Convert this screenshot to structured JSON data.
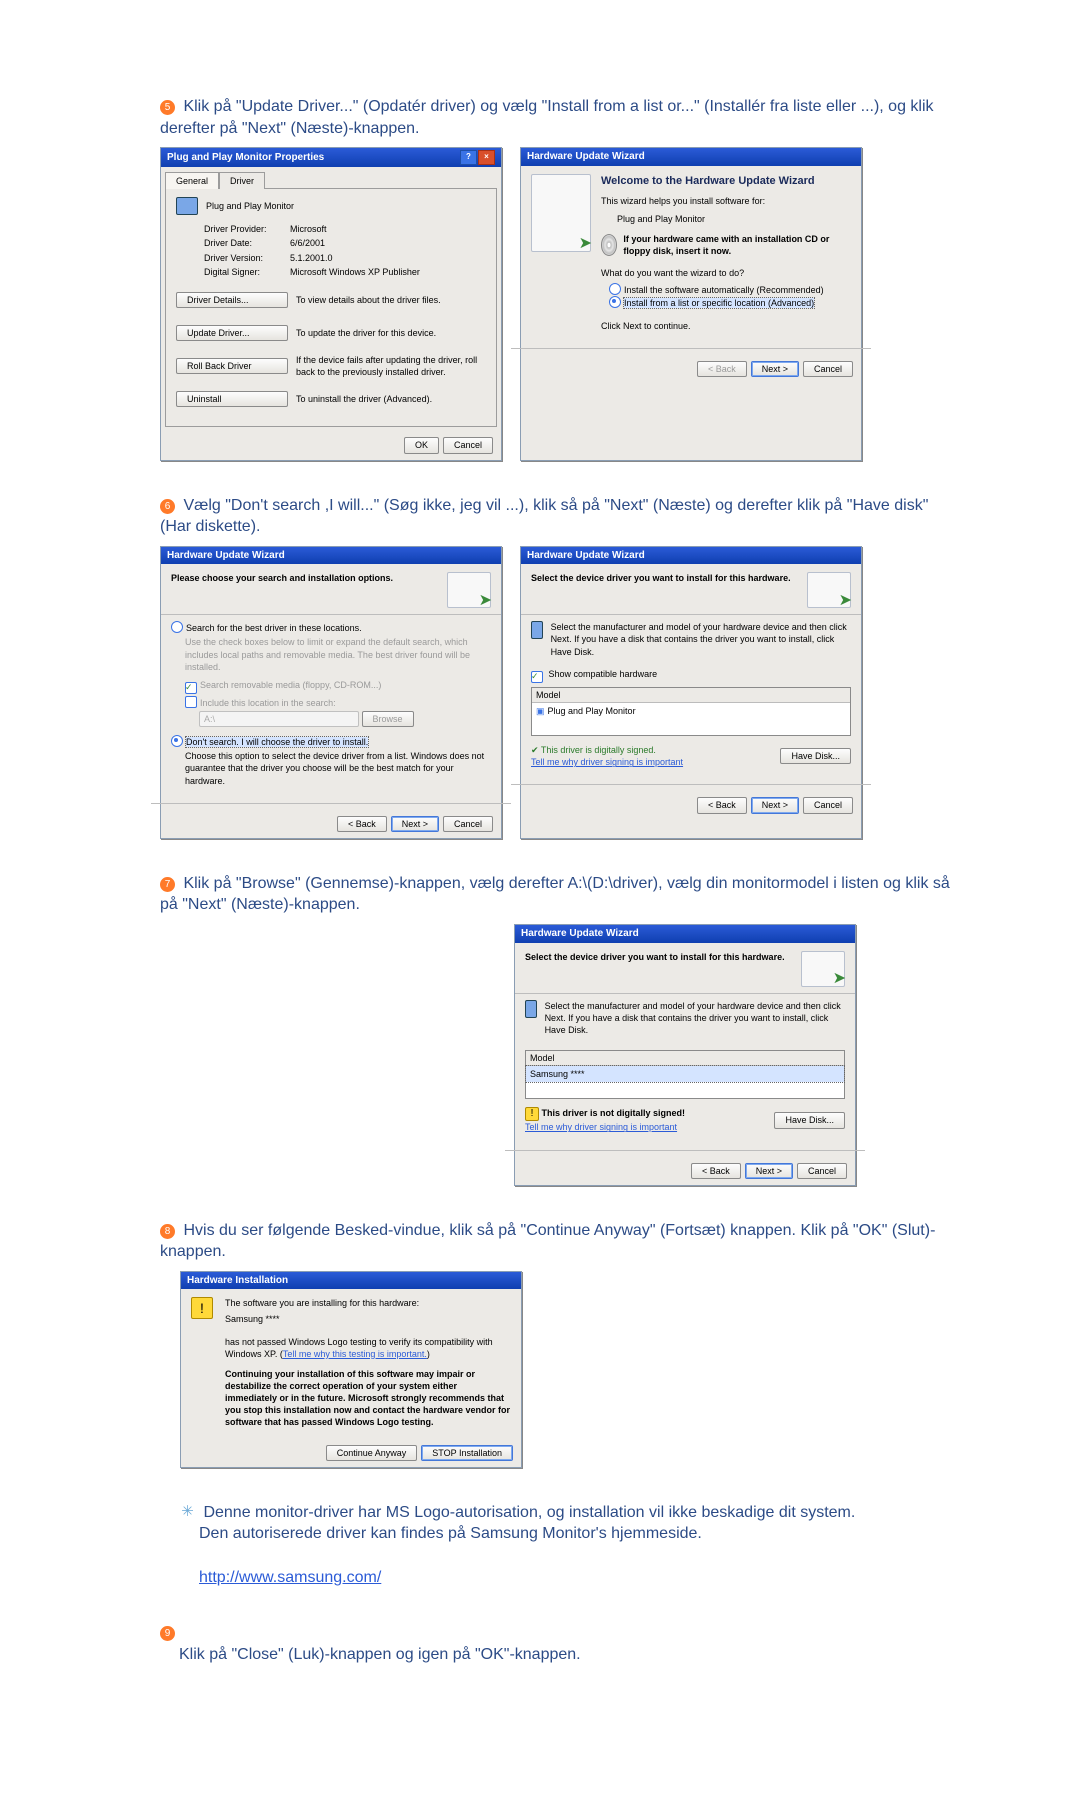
{
  "steps": {
    "s5": "Klik på \"Update Driver...\" (Opdatér driver) og vælg \"Install from a list or...\" (Installér fra liste eller ...), og klik derefter på \"Next\" (Næste)-knappen.",
    "s6": "Vælg \"Don't search ,I will...\" (Søg ikke, jeg vil ...), klik så på \"Next\" (Næste) og derefter klik på \"Have disk\" (Har diskette).",
    "s7": "Klik på \"Browse\" (Gennemse)-knappen, vælg derefter A:\\(D:\\driver), vælg din monitormodel i listen og klik så på \"Next\" (Næste)-knappen.",
    "s8": "Hvis du ser følgende Besked-vindue, klik så på \"Continue Anyway\" (Fortsæt) knappen. Klik på \"OK\" (Slut)-knappen.",
    "s9": "Klik på \"Close\" (Luk)-knappen og igen på \"OK\"-knappen."
  },
  "note": {
    "l1": "Denne monitor-driver har MS Logo-autorisation, og installation vil ikke beskadige dit system.",
    "l2": "Den autoriserede driver kan findes på Samsung Monitor's hjemmeside.",
    "link": "http://www.samsung.com/"
  },
  "common_btns": {
    "back": "< Back",
    "next": "Next >",
    "cancel": "Cancel",
    "ok": "OK",
    "have_disk": "Have Disk...",
    "browse": "Browse",
    "continue": "Continue Anyway",
    "stop": "STOP Installation"
  },
  "dlg_props": {
    "title": "Plug and Play Monitor Properties",
    "tabs": {
      "general": "General",
      "driver": "Driver"
    },
    "heading": "Plug and Play Monitor",
    "fields": {
      "provider_l": "Driver Provider:",
      "provider_v": "Microsoft",
      "date_l": "Driver Date:",
      "date_v": "6/6/2001",
      "version_l": "Driver Version:",
      "version_v": "5.1.2001.0",
      "signer_l": "Digital Signer:",
      "signer_v": "Microsoft Windows XP Publisher"
    },
    "btns": {
      "details": "Driver Details...",
      "details_d": "To view details about the driver files.",
      "update": "Update Driver...",
      "update_d": "To update the driver for this device.",
      "roll": "Roll Back Driver",
      "roll_d": "If the device fails after updating the driver, roll back to the previously installed driver.",
      "uninst": "Uninstall",
      "uninst_d": "To uninstall the driver (Advanced)."
    }
  },
  "dlg_wiz1": {
    "title": "Hardware Update Wizard",
    "welcome": "Welcome to the Hardware Update Wizard",
    "sub": "This wizard helps you install software for:",
    "device": "Plug and Play Monitor",
    "cd_hint": "If your hardware came with an installation CD or floppy disk, insert it now.",
    "q": "What do you want the wizard to do?",
    "r1": "Install the software automatically (Recommended)",
    "r2": "Install from a list or specific location (Advanced)",
    "cont": "Click Next to continue."
  },
  "dlg_wiz2": {
    "title": "Hardware Update Wizard",
    "heading": "Please choose your search and installation options.",
    "r_search": "Search for the best driver in these locations.",
    "r_search_d": "Use the check boxes below to limit or expand the default search, which includes local paths and removable media. The best driver found will be installed.",
    "c1": "Search removable media (floppy, CD-ROM...)",
    "c2": "Include this location in the search:",
    "path": "A:\\",
    "r_dont": "Don't search. I will choose the driver to install.",
    "r_dont_d": "Choose this option to select the device driver from a list. Windows does not guarantee that the driver you choose will be the best match for your hardware."
  },
  "dlg_wiz3": {
    "title": "Hardware Update Wizard",
    "heading": "Select the device driver you want to install for this hardware.",
    "sub": "Select the manufacturer and model of your hardware device and then click Next. If you have a disk that contains the driver you want to install, click Have Disk.",
    "show_compat": "Show compatible hardware",
    "model_hdr": "Model",
    "model_val": "Plug and Play Monitor",
    "signed": "This driver is digitally signed.",
    "tell": "Tell me why driver signing is important"
  },
  "dlg_wiz4": {
    "title": "Hardware Update Wizard",
    "heading": "Select the device driver you want to install for this hardware.",
    "sub": "Select the manufacturer and model of your hardware device and then click Next. If you have a disk that contains the driver you want to install, click Have Disk.",
    "model_hdr": "Model",
    "model_val": "Samsung ****",
    "unsigned": "This driver is not digitally signed!",
    "tell": "Tell me why driver signing is important"
  },
  "dlg_warn": {
    "title": "Hardware Installation",
    "l1": "The software you are installing for this hardware:",
    "dev": "Samsung ****",
    "l2a": "has not passed Windows Logo testing to verify its compatibility with Windows XP. (",
    "l2link": "Tell me why this testing is important.",
    "l2b": ")",
    "bold": "Continuing your installation of this software may impair or destabilize the correct operation of your system either immediately or in the future. Microsoft strongly recommends that you stop this installation now and contact the hardware vendor for software that has passed Windows Logo testing."
  }
}
